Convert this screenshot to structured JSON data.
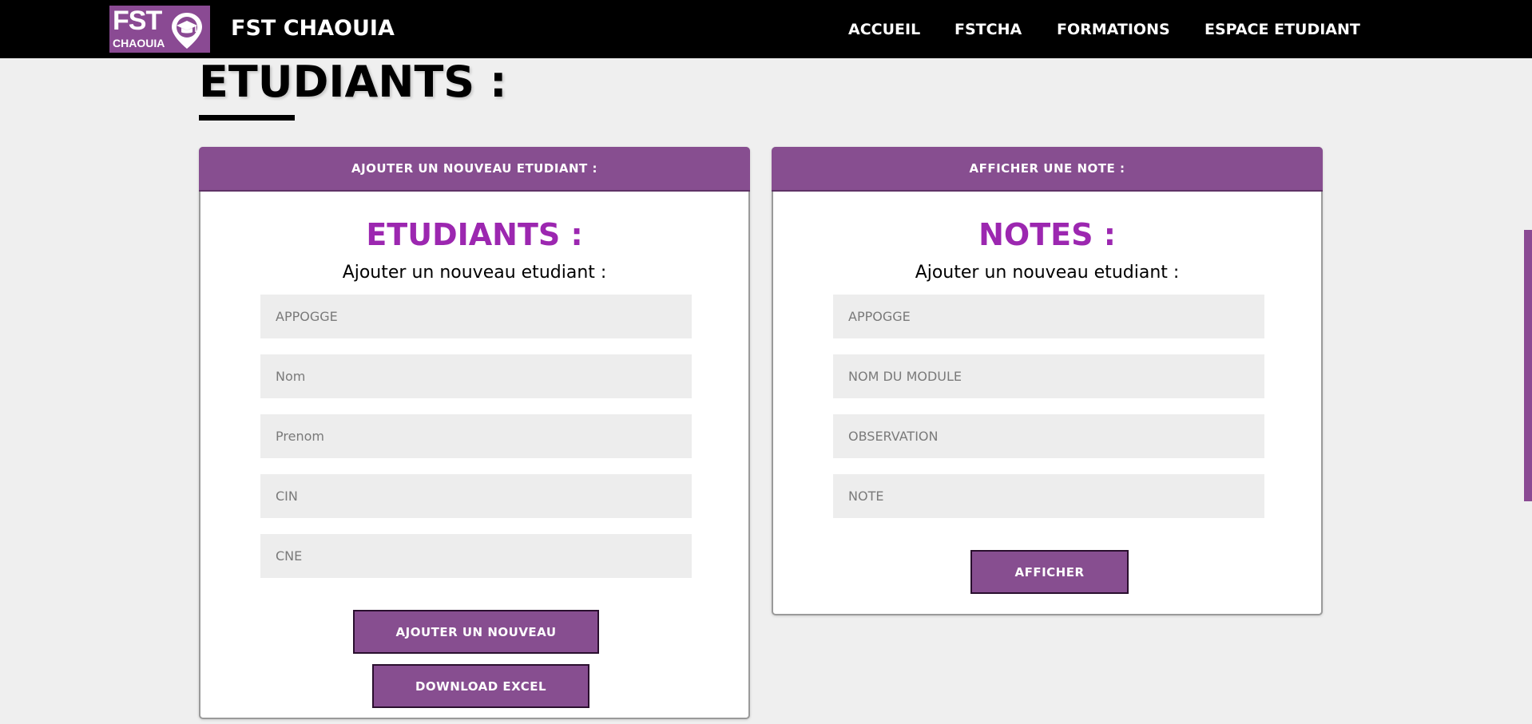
{
  "nav": {
    "logo_text": "FST",
    "logo_subtext": "CHAOUIA",
    "brand": "FST CHAOUIA",
    "links": [
      "ACCUEIL",
      "FSTCHA",
      "FORMATIONS",
      "ESPACE ETUDIANT"
    ]
  },
  "page": {
    "title": "ETUDIANTS :"
  },
  "left_card": {
    "header": "AJOUTER UN NOUVEAU ETUDIANT :",
    "heading": "ETUDIANTS :",
    "subtitle": "Ajouter un nouveau etudiant :",
    "fields": [
      "APPOGGE",
      "Nom",
      "Prenom",
      "CIN",
      "CNE"
    ],
    "buttons": {
      "add": "AJOUTER UN NOUVEAU",
      "download": "DOWNLOAD EXCEL"
    }
  },
  "right_card": {
    "header": "AFFICHER UNE NOTE :",
    "heading": "NOTES :",
    "subtitle": "Ajouter un nouveau etudiant :",
    "fields": [
      "APPOGGE",
      "NOM DU MODULE",
      "OBSERVATION",
      "NOTE"
    ],
    "buttons": {
      "show": "AFFICHER"
    }
  },
  "colors": {
    "accent": "#874e90",
    "heading": "#9c27b0",
    "navbar": "#000000",
    "background": "#efefef"
  },
  "icons": [
    "graduation-cap-pin-icon"
  ]
}
